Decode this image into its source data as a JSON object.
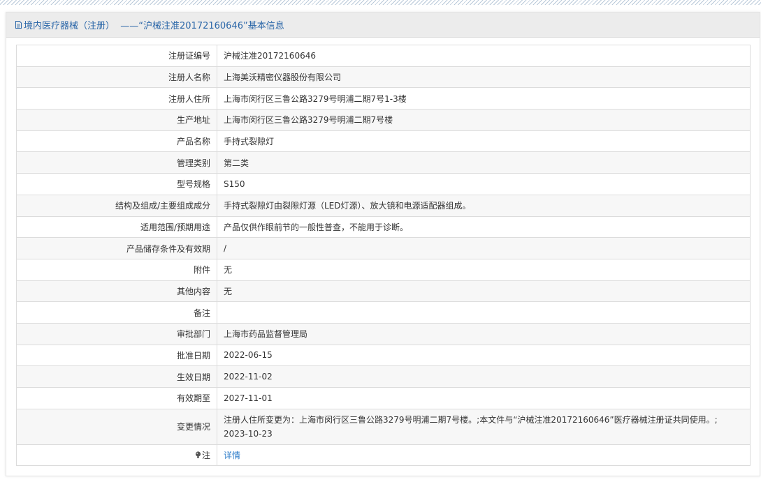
{
  "header": {
    "title": "境内医疗器械（注册）  ——“沪械注准20172160646”基本信息"
  },
  "rows": [
    {
      "label": "注册证编号",
      "value": "沪械注准20172160646"
    },
    {
      "label": "注册人名称",
      "value": "上海美沃精密仪器股份有限公司"
    },
    {
      "label": "注册人住所",
      "value": "上海市闵行区三鲁公路3279号明浦二期7号1-3楼"
    },
    {
      "label": "生产地址",
      "value": "上海市闵行区三鲁公路3279号明浦二期7号楼"
    },
    {
      "label": "产品名称",
      "value": "手持式裂隙灯"
    },
    {
      "label": "管理类别",
      "value": "第二类"
    },
    {
      "label": "型号规格",
      "value": "S150"
    },
    {
      "label": "结构及组成/主要组成成分",
      "value": "手持式裂隙灯由裂隙灯源（LED灯源）、放大镜和电源适配器组成。"
    },
    {
      "label": "适用范围/预期用途",
      "value": "产品仅供作眼前节的一般性普查，不能用于诊断。"
    },
    {
      "label": "产品储存条件及有效期",
      "value": "/"
    },
    {
      "label": "附件",
      "value": "无"
    },
    {
      "label": "其他内容",
      "value": "无"
    },
    {
      "label": "备注",
      "value": ""
    },
    {
      "label": "审批部门",
      "value": "上海市药品监督管理局"
    },
    {
      "label": "批准日期",
      "value": "2022-06-15"
    },
    {
      "label": "生效日期",
      "value": "2022-11-02"
    },
    {
      "label": "有效期至",
      "value": "2027-11-01"
    },
    {
      "label": "变更情况",
      "value": "注册人住所变更为：上海市闵行区三鲁公路3279号明浦二期7号楼。;本文件与“沪械注准20172160646”医疗器械注册证共同使用。;",
      "value2": "2023-10-23"
    }
  ],
  "note": {
    "label": "注",
    "link": "详情"
  },
  "icons": {
    "header": "document-icon",
    "note": "lightbulb-icon"
  },
  "colors": {
    "link": "#2a7ac8",
    "header_text": "#2a66a8",
    "header_bg": "#ececec"
  }
}
